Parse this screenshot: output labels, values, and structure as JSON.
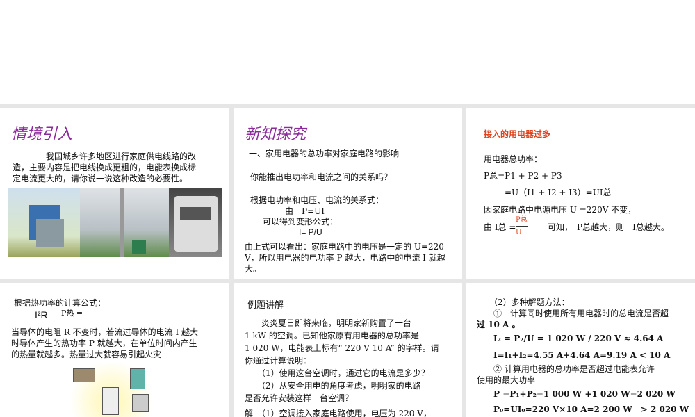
{
  "slide1": {
    "title": "情境引入",
    "para": [
      "我国城乡许多地区进行家庭供电线路的改",
      "造，主要内容是把电线换成更粗的，电能表换成标",
      "定电流更大的，请你说一说这种改造的必要性。"
    ]
  },
  "slide2": {
    "title": "新知探究",
    "heading": "一、家用电器的总功率对家庭电路的影响",
    "q": "你能推出电功率和电流之间的关系吗？",
    "l1": "根据电功率和电压、电流的关系式：",
    "l2": "由　P=UI",
    "l3": "可以得到变形公式：",
    "l4": "I= P/U",
    "c1": "由上式可以看出：家庭电路中的电压是一定的 U=220",
    "c2": "V，所以用电器的电功率 P 越大，电路中的电流 I 就越",
    "c3": "大。"
  },
  "slide3": {
    "heading": "接入的用电器过多",
    "l1": "用电器总功率：",
    "l2": "P总=P1 + P2 + P3",
    "l3": "=U（I1 + I2 + I3）=UI总",
    "l4": "因家庭电路中电源电压 U =220V 不变，",
    "l5a": "由 I总 =",
    "frac_num": "P总",
    "frac_den": "U",
    "l5b": "可知，　P总越大，则　I总越大。"
  },
  "slide4": {
    "l1": "根据热功率的计算公式：",
    "f1": "I²R",
    "f2": "P热 =",
    "p": [
      "当导体的电阻 R 不变时，若流过导体的电流 I 越大",
      "时导体产生的热功率 P 就越大，在单位时间内产生",
      "的热量就越多。热量过大就容易引起火灾"
    ]
  },
  "slide5": {
    "heading": "例题讲解",
    "p": [
      "　　炎炎夏日即将来临，明明家新购置了一台",
      "1 kW 的空调。已知他家原有用电器的总功率是",
      "1 020 W，电能表上标有“ 220 V 10 A” 的字样。请",
      "你通过计算说明：",
      "　　（1）使用这台空调时，通过它的电流是多少？",
      "　　（2）从安全用电的角度考虑，明明家的电路",
      "是否允许安装这样一台空调？",
      "解　（1）空调接入家庭电路使用，电压为 220 V，"
    ]
  },
  "slide6": {
    "p": [
      "　　（2）多种解题方法：",
      "　　①　计算同时使用所有用电器时的总电流是否超",
      "过 10 A 。",
      "　　I₂ = P₂/U = 1 020 W / 220 V ≈ 4.64 A",
      "　　I=I₁+I₂=4.55 A+4.64 A=9.19 A < 10 A",
      "　　② 计算用电器的总功率是否超过电能表允许",
      "使用的最大功率",
      "　　P =P₁+P₂=1 000 W +1 020 W=2 020 W",
      "　　P₀=UI₀=220 V×10 A=2 200 W　> 2 020 W"
    ]
  }
}
